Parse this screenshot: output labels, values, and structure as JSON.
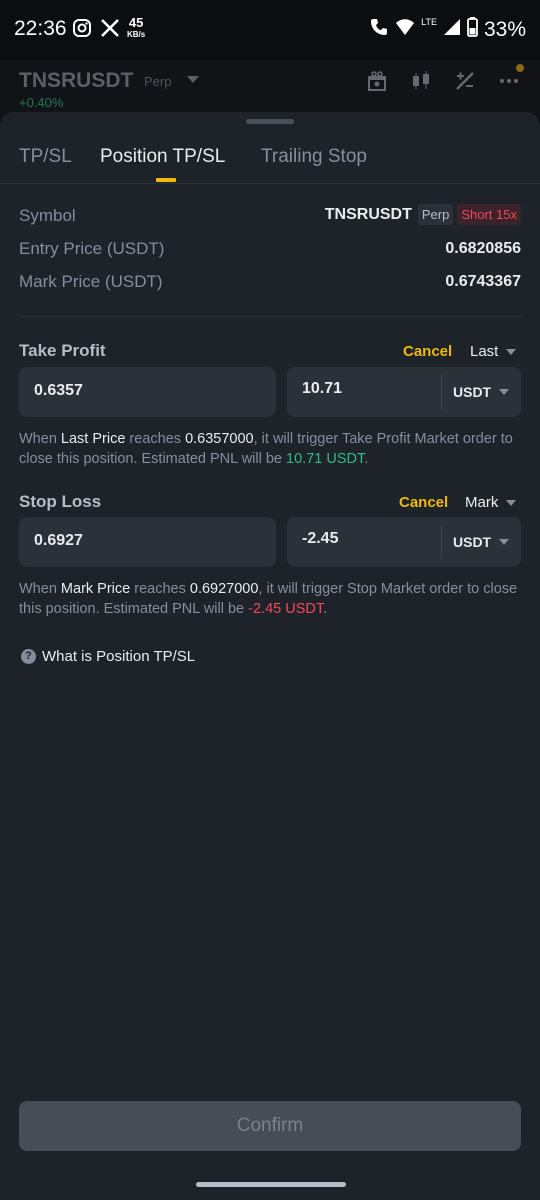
{
  "status_bar": {
    "time": "22:36",
    "speed_value": "45",
    "speed_unit": "KB/s",
    "network": "LTE",
    "battery": "33%"
  },
  "background_header": {
    "symbol": "TNSRUSDT",
    "type": "Perp",
    "change": "+0.40%"
  },
  "tabs": [
    {
      "label": "TP/SL",
      "active": false
    },
    {
      "label": "Position TP/SL",
      "active": true
    },
    {
      "label": "Trailing Stop",
      "active": false
    }
  ],
  "info": {
    "symbol_label": "Symbol",
    "symbol_value": "TNSRUSDT",
    "symbol_type": "Perp",
    "position_badge": "Short 15x",
    "entry_label": "Entry Price (USDT)",
    "entry_value": "0.6820856",
    "mark_label": "Mark Price (USDT)",
    "mark_value": "0.6743367"
  },
  "take_profit": {
    "title": "Take Profit",
    "cancel": "Cancel",
    "trigger_type": "Last",
    "price": "0.6357",
    "pnl": "10.71",
    "unit": "USDT",
    "note": {
      "p1": "When ",
      "price_type": "Last Price",
      "p2": " reaches ",
      "trigger_price": "0.6357000",
      "p3": ", it will trigger Take Profit Market order to close this position. Estimated PNL will be ",
      "pnl": "10.71 USDT",
      "p4": "."
    }
  },
  "stop_loss": {
    "title": "Stop Loss",
    "cancel": "Cancel",
    "trigger_type": "Mark",
    "price": "0.6927",
    "pnl": "-2.45",
    "unit": "USDT",
    "note": {
      "p1": "When ",
      "price_type": "Mark Price",
      "p2": " reaches ",
      "trigger_price": "0.6927000",
      "p3": ", it will trigger Stop Market order to close this position. Estimated PNL will be ",
      "pnl": "-2.45 USDT",
      "p4": "."
    }
  },
  "help_link": "What is Position TP/SL",
  "confirm_label": "Confirm",
  "colors": {
    "accent": "#f0b90b",
    "positive": "#2ebd85",
    "negative": "#f6465d"
  }
}
